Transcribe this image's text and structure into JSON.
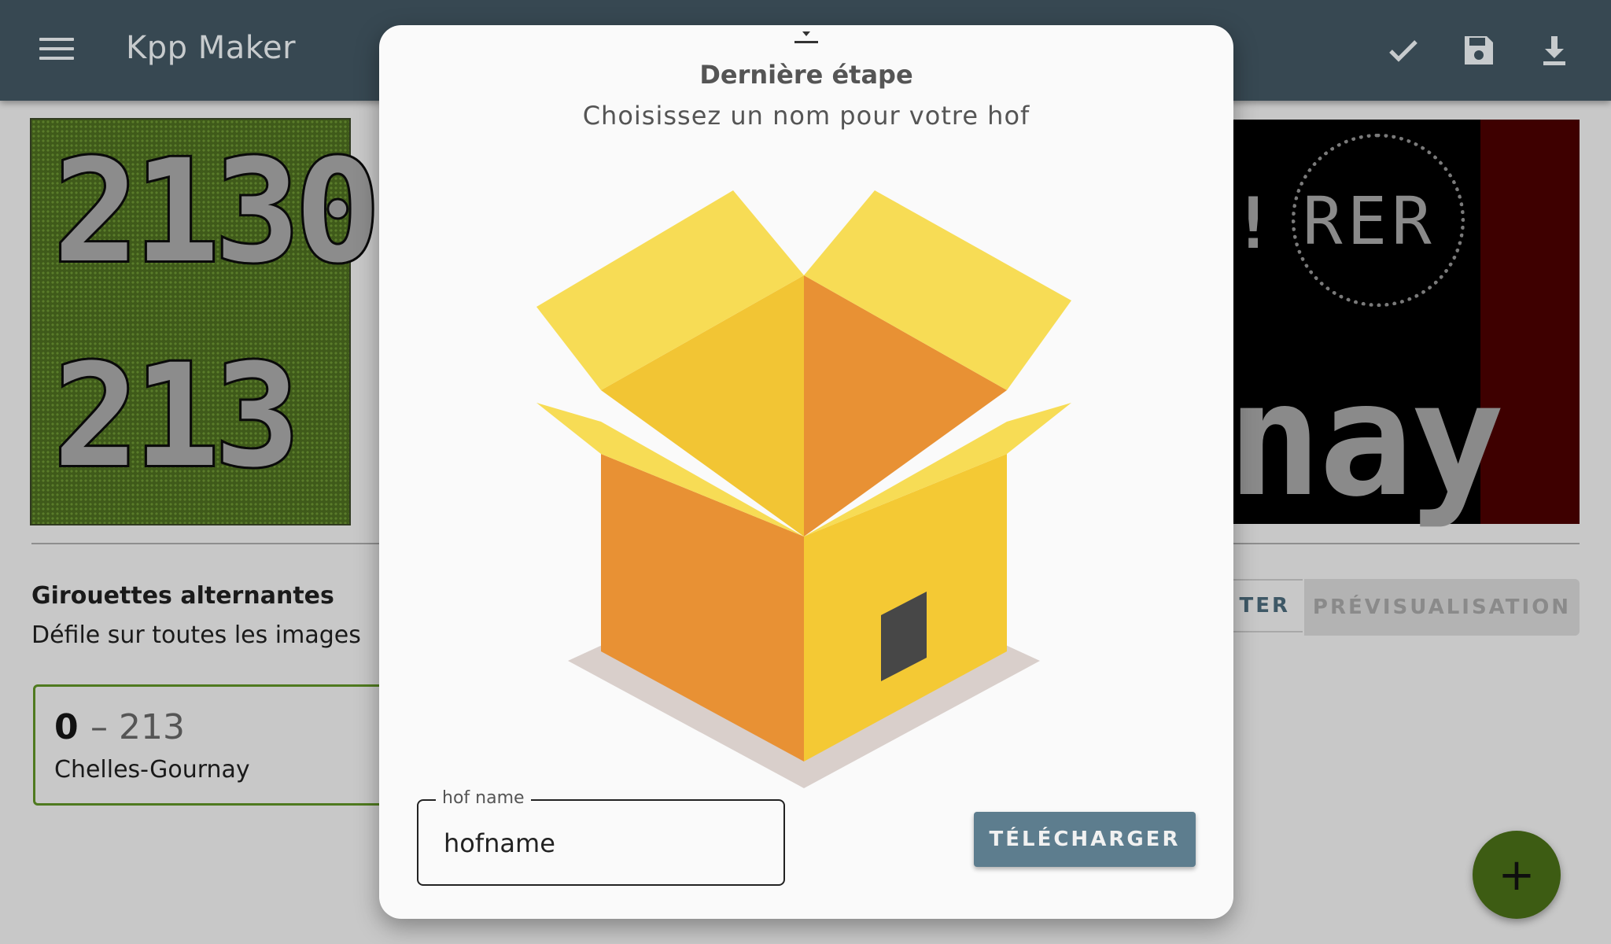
{
  "app_bar": {
    "title": "Kpp Maker",
    "icons": [
      "menu-icon",
      "check-icon",
      "save-icon",
      "download-icon"
    ],
    "color": "#374852"
  },
  "preview": {
    "left_top_text": "2130",
    "left_bottom_text": "213",
    "right_badge": "RER",
    "right_exclaim": "!",
    "right_bottom_text": "nay"
  },
  "section": {
    "title": "Girouettes alternantes",
    "subtitle": "Défile sur toutes les images"
  },
  "card": {
    "index": "0",
    "separator_value": "– 213",
    "subtitle": "Chelles-Gournay"
  },
  "buttons": {
    "partial_label": "TER",
    "preview_label": "PRÉVISUALISATION"
  },
  "fab": {
    "label": "+"
  },
  "dialog": {
    "title": "Dernière étape",
    "subtitle": "Choisissez un nom pour votre hof",
    "field": {
      "label": "hof name",
      "value": "hofname"
    },
    "download_label": "TÉLÉCHARGER"
  },
  "colors": {
    "accent": "#5d7d8e",
    "fab": "#3d5c13",
    "box_yellow": "#f4c934",
    "box_orange": "#e89134",
    "box_flap": "#f7dc55"
  }
}
